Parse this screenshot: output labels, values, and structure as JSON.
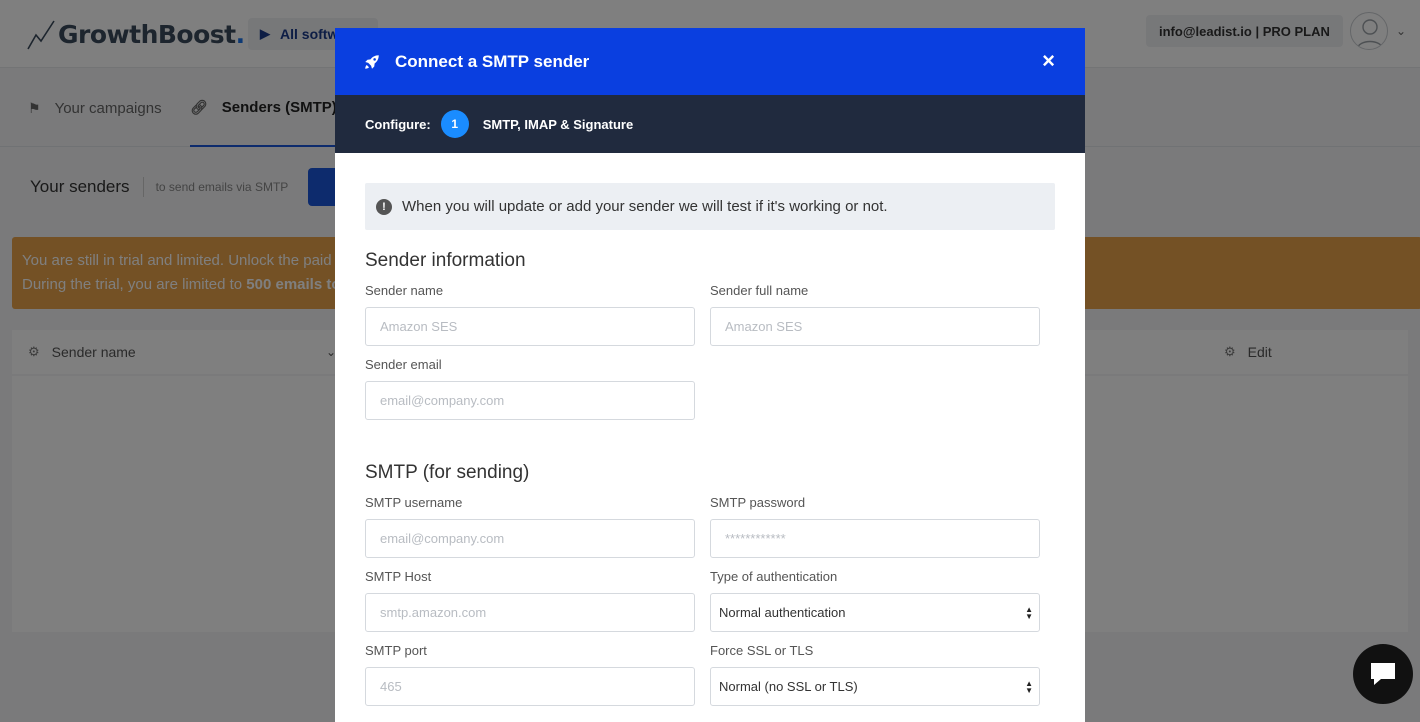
{
  "app": {
    "logo_text": "GrowthBoost",
    "logo_dot": ".",
    "all_software_label": "All softw",
    "account_label": "info@leadist.io | PRO PLAN"
  },
  "tabs": [
    {
      "label": "Your campaigns",
      "icon": "flag-icon"
    },
    {
      "label": "Senders (SMTP)",
      "icon": "link-icon",
      "active": true
    }
  ],
  "senders": {
    "title": "Your senders",
    "subtitle": "to send emails via SMTP"
  },
  "trial_banner": {
    "line1": "You are still in trial and limited. Unlock the paid",
    "line2_prefix": "During the trial, you are limited to ",
    "line2_highlight": "500 emails to"
  },
  "table": {
    "columns": [
      {
        "label": "Sender name",
        "icon": "gear-icon"
      },
      {
        "label": "Edit",
        "icon": "gear-icon"
      }
    ]
  },
  "modal": {
    "title": "Connect a SMTP sender",
    "close_glyph": "×",
    "steps_label": "Configure:",
    "step_number": "1",
    "step_name": "SMTP, IMAP & Signature",
    "notice": "When you will update or add your sender we will test if it's working or not.",
    "sender_section": {
      "title": "Sender information",
      "sender_name": {
        "label": "Sender name",
        "placeholder": "Amazon SES"
      },
      "sender_full_name": {
        "label": "Sender full name",
        "placeholder": "Amazon SES"
      },
      "sender_email": {
        "label": "Sender email",
        "placeholder": "email@company.com"
      }
    },
    "smtp_section": {
      "title": "SMTP (for sending)",
      "username": {
        "label": "SMTP username",
        "placeholder": "email@company.com"
      },
      "password": {
        "label": "SMTP password",
        "placeholder": "************"
      },
      "host": {
        "label": "SMTP Host",
        "placeholder": "smtp.amazon.com"
      },
      "auth_type": {
        "label": "Type of authentication",
        "value": "Normal authentication"
      },
      "port": {
        "label": "SMTP port",
        "placeholder": "465"
      },
      "ssl": {
        "label": "Force SSL or TLS",
        "value": "Normal (no SSL or TLS)"
      }
    }
  },
  "colors": {
    "modal_header": "#0a3fe0",
    "steps_bar": "#202a3e",
    "step_badge": "#1a8cff",
    "trial_banner": "#e8a24a"
  }
}
